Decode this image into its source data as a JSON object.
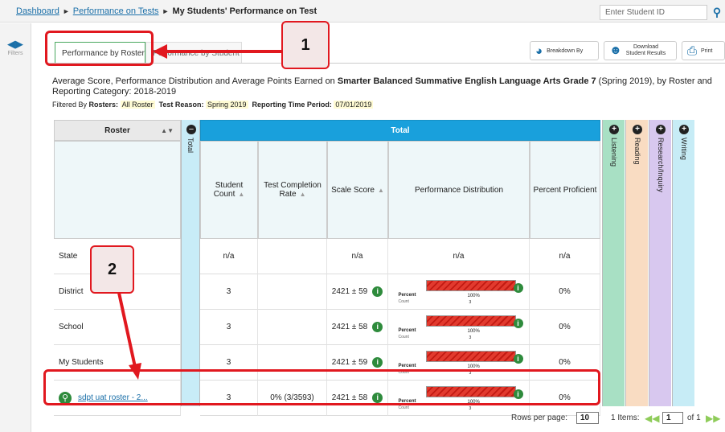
{
  "breadcrumb": {
    "dashboard": "Dashboard",
    "perf_tests": "Performance on Tests",
    "current": "My Students' Performance on Test"
  },
  "student_search": {
    "placeholder": "Enter Student ID"
  },
  "left_rail": {
    "filters_label": "Filters"
  },
  "tabs": [
    {
      "label": "Performance by Roster"
    },
    {
      "label": "Performance by Student"
    }
  ],
  "toolbar": {
    "breakdown": "Breakdown By",
    "download": "Download\nStudent Results",
    "print": "Print"
  },
  "heading": {
    "prefix": "Average Score, Performance Distribution and Average Points Earned on ",
    "test": "Smarter Balanced Summative English Language Arts Grade 7",
    "suffix": " (Spring 2019), by Roster and Reporting Category: 2018-2019"
  },
  "filters": {
    "label": "Filtered By",
    "rosters_label": "Rosters:",
    "rosters_value": "All Roster",
    "reason_label": "Test Reason:",
    "reason_value": "Spring 2019",
    "period_label": "Reporting Time Period:",
    "period_value": "07/01/2019"
  },
  "table": {
    "roster_header": "Roster",
    "total_vertical": "Total",
    "total_header": "Total",
    "columns": [
      "Student Count",
      "Test Completion Rate",
      "Scale Score",
      "Performance Distribution",
      "Percent Proficient"
    ],
    "claims": [
      "Listening",
      "Reading",
      "Research/Inquiry",
      "Writing"
    ],
    "claim_colors": [
      "#a8e0c4",
      "#f9dcc2",
      "#d8c8ef",
      "#c7ecf6"
    ],
    "rows": [
      {
        "name": "State",
        "count": "n/a",
        "completion": "",
        "score": "n/a",
        "dist_text": "n/a",
        "proficient": "n/a"
      },
      {
        "name": "District",
        "count": "3",
        "completion": "",
        "score": "2421 ± 59",
        "dist_percent": "100%",
        "dist_count": "3",
        "proficient": "0%"
      },
      {
        "name": "School",
        "count": "3",
        "completion": "",
        "score": "2421 ± 58",
        "dist_percent": "100%",
        "dist_count": "3",
        "proficient": "0%"
      },
      {
        "name": "My Students",
        "count": "3",
        "completion": "",
        "score": "2421 ± 59",
        "dist_percent": "100%",
        "dist_count": "3",
        "proficient": "0%"
      },
      {
        "name": "sdpt uat roster - 2...",
        "count": "3",
        "completion": "0% (3/3593)",
        "score": "2421 ± 58",
        "dist_percent": "100%",
        "dist_count": "3",
        "proficient": "0%"
      }
    ],
    "dist_percent_label": "Percent",
    "dist_count_label": "Count"
  },
  "pager": {
    "rows_label": "Rows per page:",
    "rows_value": "10",
    "items": "1 Items:",
    "page": "1",
    "of": "of 1"
  },
  "callouts": {
    "one": "1",
    "two": "2"
  }
}
